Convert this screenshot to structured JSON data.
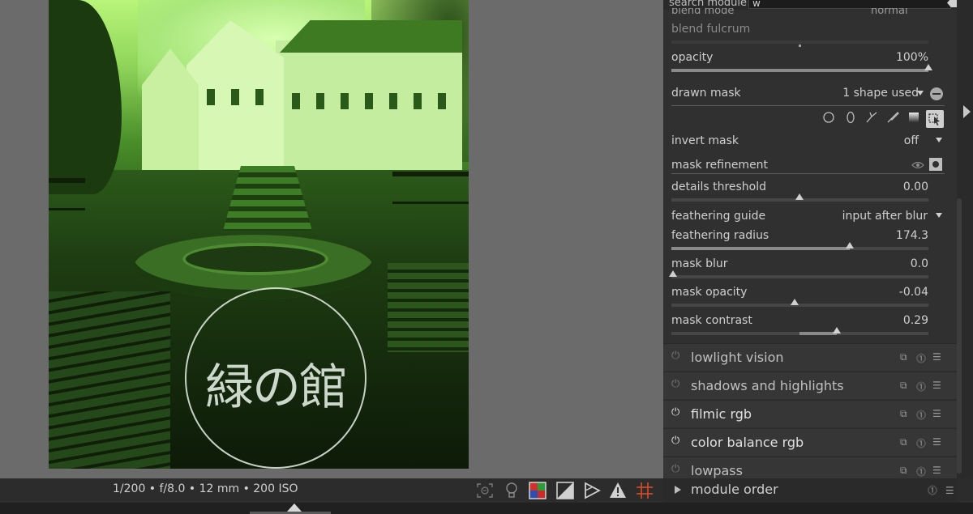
{
  "search": {
    "label": "search module",
    "value": "w"
  },
  "blend": {
    "mode_label": "blend mode",
    "mode_value": "normal",
    "fulcrum_label": "blend fulcrum",
    "opacity_label": "opacity",
    "opacity_value": "100%"
  },
  "drawn_mask": {
    "label": "drawn mask",
    "value": "1 shape used"
  },
  "invert_mask": {
    "label": "invert mask",
    "value": "off"
  },
  "mask_refinement": {
    "label": "mask refinement"
  },
  "sliders": {
    "details_threshold": {
      "label": "details threshold",
      "value": "0.00"
    },
    "feathering_radius": {
      "label": "feathering radius",
      "value": "174.3"
    },
    "mask_blur": {
      "label": "mask blur",
      "value": "0.0"
    },
    "mask_opacity": {
      "label": "mask opacity",
      "value": "-0.04"
    },
    "mask_contrast": {
      "label": "mask contrast",
      "value": "0.29"
    }
  },
  "feathering_guide": {
    "label": "feathering guide",
    "value": "input after blur"
  },
  "modules": [
    {
      "name": "lowlight vision",
      "on": false
    },
    {
      "name": "shadows and highlights",
      "on": false
    },
    {
      "name": "filmic rgb",
      "on": true
    },
    {
      "name": "color balance rgb",
      "on": true
    },
    {
      "name": "lowpass",
      "on": false
    }
  ],
  "module_order": {
    "label": "module order"
  },
  "exif": "1/200 • f/8.0 • 12 mm • 200 ISO",
  "watermark_text": "緑の館",
  "icons": {
    "power": "⏻",
    "multi": "⧉",
    "reset": "⓵",
    "presets": "☰"
  },
  "colors": {
    "panel_bg": "#303030",
    "accent_green": "#6fc13c"
  }
}
